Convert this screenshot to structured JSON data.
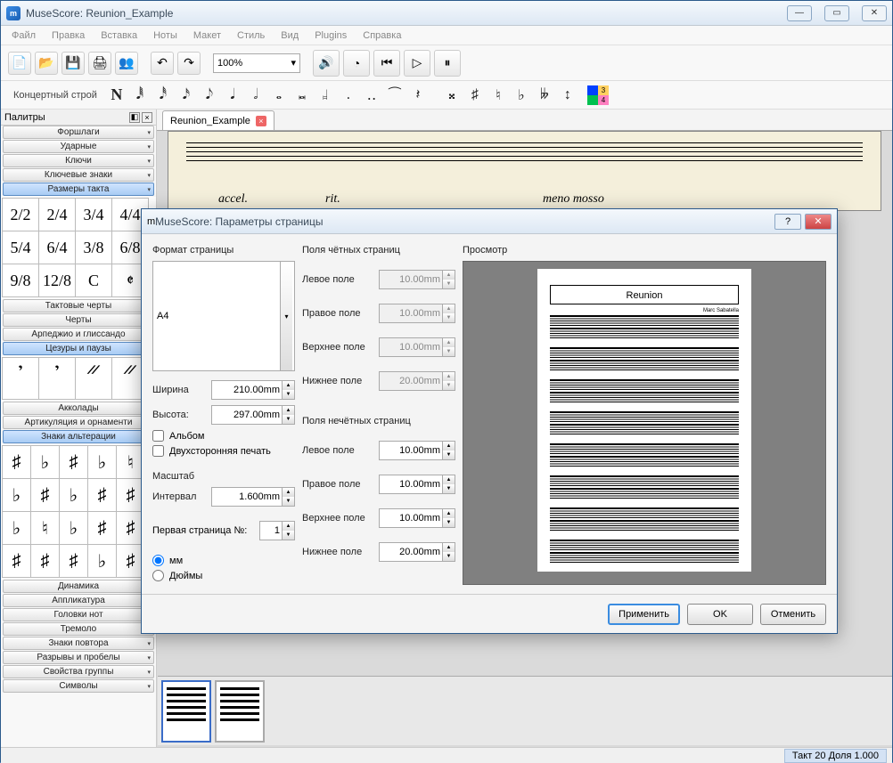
{
  "window": {
    "title": "MuseScore: Reunion_Example"
  },
  "menu": [
    "Файл",
    "Правка",
    "Вставка",
    "Ноты",
    "Макет",
    "Стиль",
    "Вид",
    "Plugins",
    "Справка"
  ],
  "toolbar": {
    "zoom": "100%"
  },
  "note_toolbar": {
    "pitch_label": "Концертный строй",
    "voices": [
      "1",
      "2",
      "3",
      "4"
    ]
  },
  "sidebar": {
    "title": "Палитры",
    "items_top": [
      "Форшлаги",
      "Ударные",
      "Ключи",
      "Ключевые знаки",
      "Размеры такта"
    ],
    "time_sigs": [
      "2/2",
      "2/4",
      "3/4",
      "4/4",
      "5/4",
      "6/4",
      "3/8",
      "6/8",
      "9/8",
      "12/8",
      "C",
      "𝄵"
    ],
    "items_mid": [
      "Тактовые черты",
      "Черты",
      "Арпеджио и глиссандо",
      "Цезуры и паузы"
    ],
    "breath_marks": [
      "𝄒",
      "𝄒",
      "𝄓",
      "𝄓"
    ],
    "items_mid2": [
      "Акколады",
      "Артикуляция и орнаменти",
      "Знаки альтерации"
    ],
    "accidentals": [
      "♯",
      "♭",
      "♯",
      "♭",
      "♮",
      "♭",
      "♯",
      "♭",
      "♯",
      "♯",
      "♭",
      "♮",
      "♭",
      "♯",
      "♯",
      "♯",
      "♯",
      "♯",
      "♭",
      "♯"
    ],
    "items_bottom": [
      "Динамика",
      "Аппликатура",
      "Головки нот",
      "Тремоло",
      "Знаки повтора",
      "Разрывы и пробелы",
      "Свойства группы",
      "Символы"
    ]
  },
  "document": {
    "tab_name": "Reunion_Example",
    "tempo1": "accel.",
    "tempo2": "rit.",
    "tempo3": "meno mosso"
  },
  "dialog": {
    "title": "MuseScore: Параметры страницы",
    "format_label": "Формат страницы",
    "paper": "A4",
    "width_label": "Ширина",
    "width": "210.00mm",
    "height_label": "Высота:",
    "height": "297.00mm",
    "landscape": "Альбом",
    "duplex": "Двухсторонняя печать",
    "scale_label": "Масштаб",
    "interval_label": "Интервал",
    "interval": "1.600mm",
    "first_page_label": "Первая страница №:",
    "first_page": "1",
    "unit_mm": "мм",
    "unit_inch": "Дюймы",
    "even_margins": "Поля чётных страниц",
    "odd_margins": "Поля нечётных страниц",
    "left_label": "Левое поле",
    "right_label": "Правое поле",
    "top_label": "Верхнее поле",
    "bottom_label": "Нижнее поле",
    "even": {
      "left": "10.00mm",
      "right": "10.00mm",
      "top": "10.00mm",
      "bottom": "20.00mm"
    },
    "odd": {
      "left": "10.00mm",
      "right": "10.00mm",
      "top": "10.00mm",
      "bottom": "20.00mm"
    },
    "preview_label": "Просмотр",
    "preview_title": "Reunion",
    "apply": "Применить",
    "ok": "OK",
    "cancel": "Отменить"
  },
  "status": {
    "measure": "Такт  20 Доля  1.000"
  }
}
